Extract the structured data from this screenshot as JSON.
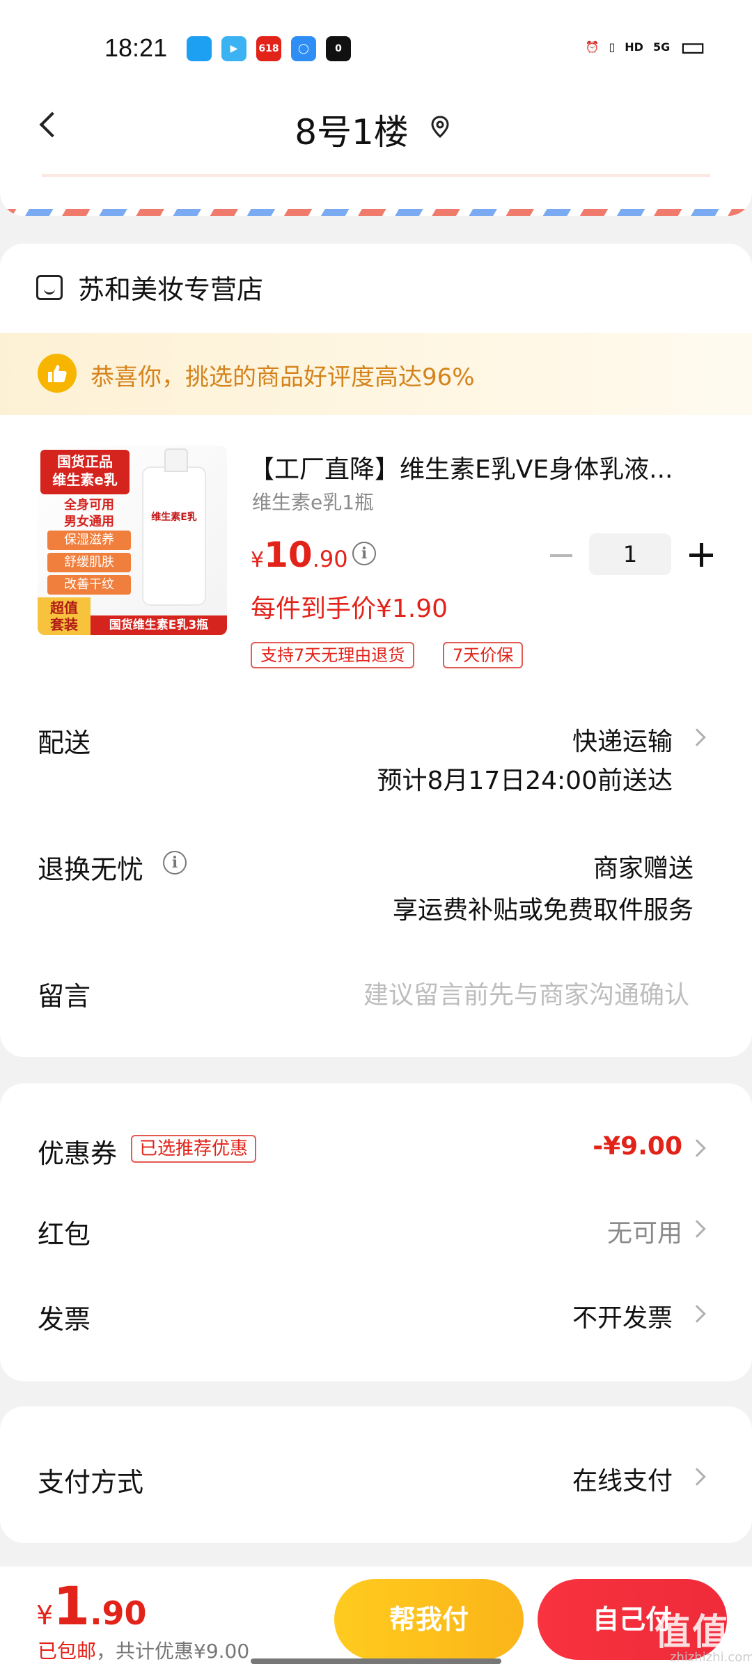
{
  "status": {
    "time": "18:21",
    "apps": [
      {
        "name": "qq-icon",
        "color": "#1ea0f2",
        "glyph": ""
      },
      {
        "name": "video-icon",
        "color": "#3bb3f3",
        "glyph": "▶"
      },
      {
        "name": "shopping-618-icon",
        "color": "#e2231a",
        "glyph": "618"
      },
      {
        "name": "browser-icon",
        "color": "#2f8ef5",
        "glyph": "◯"
      },
      {
        "name": "notes-icon",
        "color": "#111111",
        "glyph": "0"
      }
    ],
    "right": [
      {
        "name": "alarm-icon",
        "glyph": "⏰"
      },
      {
        "name": "vibrate-icon",
        "glyph": "▯"
      },
      {
        "name": "hd-icon",
        "glyph": "HD"
      },
      {
        "name": "signal-5g-icon",
        "glyph": "5G"
      },
      {
        "name": "battery-icon",
        "glyph": "▭"
      }
    ]
  },
  "header": {
    "title": "8号1楼"
  },
  "shop": {
    "name": "苏和美妆专营店",
    "congrats": "恭喜你，挑选的商品好评度高达96%"
  },
  "product": {
    "image_text": {
      "tag1": "国货正品\n维生素e乳",
      "tag2": "全身可用\n男女通用",
      "pills": [
        "保湿滋养",
        "舒缓肌肤",
        "改善干纹"
      ],
      "bottle_label": "维生素E乳",
      "super": "超值\n套装",
      "banner": "国货维生素E乳3瓶"
    },
    "title": "【工厂直降】维生素E乳VE身体乳液...",
    "spec": "维生素e乳1瓶",
    "price_currency": "¥",
    "price_int": "10",
    "price_dec": ".90",
    "quantity": "1",
    "unit_price": "每件到手价¥1.90",
    "badges": [
      "支持7天无理由退货",
      "7天价保"
    ]
  },
  "delivery": {
    "label": "配送",
    "method": "快递运输",
    "eta": "预计8月17日24:00前送达"
  },
  "returns": {
    "label": "退换无忧",
    "value": "商家赠送",
    "desc": "享运费补贴或免费取件服务"
  },
  "message": {
    "label": "留言",
    "placeholder": "建议留言前先与商家沟通确认"
  },
  "discounts": {
    "coupon_label": "优惠券",
    "coupon_tag": "已选推荐优惠",
    "coupon_value": "-¥9.00",
    "redpack_label": "红包",
    "redpack_value": "无可用",
    "invoice_label": "发票",
    "invoice_value": "不开发票"
  },
  "payment": {
    "label": "支付方式",
    "value": "在线支付"
  },
  "footer": {
    "total_currency": "¥",
    "total_int": "1",
    "total_dec": ".90",
    "shipping": "已包邮",
    "saved": "，共计优惠¥9.00",
    "help_pay": "帮我付",
    "self_pay": "自己付",
    "watermark": "值值值",
    "watermark_sub": "zhizhizhi.com"
  },
  "colors": {
    "accent_red": "#e2231a",
    "help_btn": "#fbb519",
    "self_btn": "#f8323e"
  }
}
